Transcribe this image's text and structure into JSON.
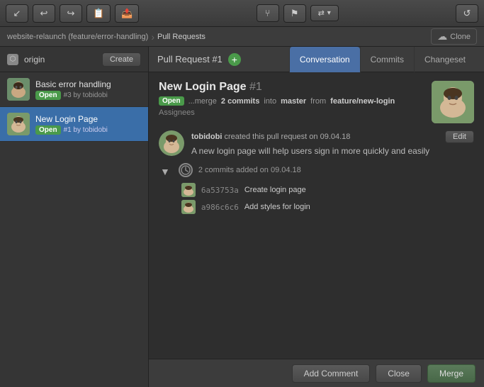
{
  "toolbar": {
    "buttons": [
      {
        "label": "↙",
        "name": "fetch-btn"
      },
      {
        "label": "⬅",
        "name": "pull-btn"
      },
      {
        "label": "➡",
        "name": "push-btn"
      },
      {
        "label": "📋",
        "name": "stash-btn"
      },
      {
        "label": "📤",
        "name": "pop-btn"
      },
      {
        "label": "⑂",
        "name": "branch-btn"
      },
      {
        "label": "⚠",
        "name": "tag-btn"
      },
      {
        "label": "⇄ ▾",
        "name": "git-flow-btn"
      },
      {
        "label": "↺",
        "name": "refresh-btn"
      }
    ]
  },
  "breadcrumb": {
    "repo": "website-relaunch (feature/error-handling)",
    "section": "Pull Requests",
    "clone_label": "Clone"
  },
  "sidebar": {
    "origin_label": "origin",
    "create_btn_label": "Create",
    "items": [
      {
        "id": "pr-1",
        "title": "Basic error handling",
        "status": "Open",
        "meta": "#3 by tobidobi",
        "active": false
      },
      {
        "id": "pr-2",
        "title": "New Login Page",
        "status": "Open",
        "meta": "#1 by tobidobi",
        "active": true
      }
    ]
  },
  "content": {
    "pr_header": {
      "label": "Pull Request #1",
      "add_title": "+"
    },
    "tabs": [
      {
        "label": "Conversation",
        "active": true
      },
      {
        "label": "Commits",
        "active": false
      },
      {
        "label": "Changeset",
        "active": false
      }
    ],
    "pr_title": "New Login Page",
    "pr_number": "#1",
    "pr_status_badge": "Open",
    "pr_status_text": "...merge",
    "pr_commits_count": "2 commits",
    "pr_status_into": "into",
    "pr_target_branch": "master",
    "pr_status_from": "from",
    "pr_source_branch": "feature/new-login",
    "assignees_label": "Assignees",
    "activity": {
      "author": "tobidobi",
      "action": "created this pull request on",
      "date": "09.04.18",
      "edit_label": "Edit",
      "comment": "A new login page will help users sign in more quickly and easily"
    },
    "commits_section": {
      "summary": "2 commits added on 09.04.18",
      "commits": [
        {
          "hash": "6a53753a",
          "message": "Create login page"
        },
        {
          "hash": "a986c6c6",
          "message": "Add styles for login"
        }
      ]
    }
  },
  "footer": {
    "add_comment_label": "Add Comment",
    "close_label": "Close",
    "merge_label": "Merge"
  }
}
